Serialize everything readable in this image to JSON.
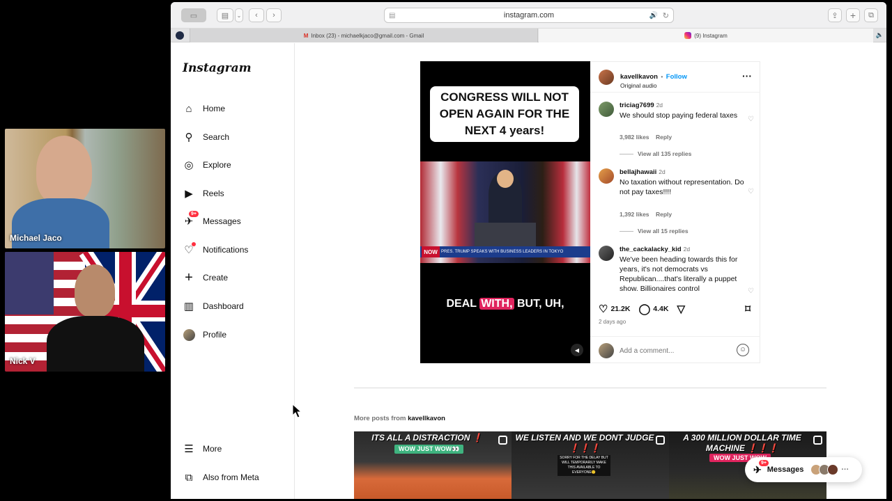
{
  "participants": [
    {
      "name": "Michael Jaco"
    },
    {
      "name": "Nick V"
    }
  ],
  "browser": {
    "url": "instagram.com",
    "tabs": [
      {
        "label": "Inbox (23) - michaelkjaco@gmail.com - Gmail"
      },
      {
        "label": "(9) Instagram"
      }
    ]
  },
  "sidebar": {
    "logo": "Instagram",
    "messages_badge": "9+",
    "items": [
      {
        "label": "Home",
        "icon": "home-icon"
      },
      {
        "label": "Search",
        "icon": "search-icon"
      },
      {
        "label": "Explore",
        "icon": "compass-icon"
      },
      {
        "label": "Reels",
        "icon": "reels-icon"
      },
      {
        "label": "Messages",
        "icon": "messenger-icon"
      },
      {
        "label": "Notifications",
        "icon": "heart-icon"
      },
      {
        "label": "Create",
        "icon": "plus-icon"
      },
      {
        "label": "Dashboard",
        "icon": "dashboard-icon"
      },
      {
        "label": "Profile",
        "icon": "avatar-icon"
      }
    ],
    "bottom": [
      {
        "label": "More",
        "icon": "menu-icon"
      },
      {
        "label": "Also from Meta",
        "icon": "meta-icon"
      }
    ]
  },
  "post": {
    "username": "kavellkavon",
    "follow_label": "Follow",
    "separator": "•",
    "audio": "Original audio",
    "caption": "CONGRESS WILL NOT OPEN AGAIN FOR THE NEXT 4 years!",
    "ticker_tag": "NOW",
    "ticker_text": "PRES. TRUMP SPEAKS WITH BUSINESS LEADERS IN TOKYO",
    "subtitle_pre": "DEAL ",
    "subtitle_hl": "WITH,",
    "subtitle_post": " BUT, UH,",
    "comments": [
      {
        "user": "triciag7699",
        "age": "2d",
        "text": "We should stop paying federal taxes",
        "likes": "3,982 likes",
        "reply": "Reply",
        "view_replies": "View all 135 replies"
      },
      {
        "user": "bellajhawaii",
        "age": "2d",
        "text": "No taxation without representation. Do not pay taxes!!!!",
        "likes": "1,392 likes",
        "reply": "Reply",
        "view_replies": "View all 15 replies"
      },
      {
        "user": "the_cackalacky_kid",
        "age": "2d",
        "text": "We've been heading towards this for years, it's not democrats vs Republican....that's literally a puppet show. Billionaires control"
      }
    ],
    "likes": "21.2K",
    "comments_count": "4.4K",
    "posted": "2 days ago",
    "add_comment_placeholder": "Add a comment..."
  },
  "more_posts": {
    "label": "More posts from",
    "user": "kavellkavon",
    "thumbs": [
      {
        "title": "ITS ALL A DISTRACTION ❗",
        "tag": "WOW JUST WOW👀"
      },
      {
        "title": "WE LISTEN AND WE DONT JUDGE ❗❗❗",
        "tag": "SORRY FOR THE DELAY BUT WILL TEMPORARILY MAKE THIS AVAILABLE TO EVERYONE🙂"
      },
      {
        "title": "A 300 MILLION DOLLAR TIME MACHINE ❗❗❗",
        "tag": "WOW JUST WOW"
      }
    ]
  },
  "messages_bar": {
    "label": "Messages",
    "badge": "9+"
  }
}
